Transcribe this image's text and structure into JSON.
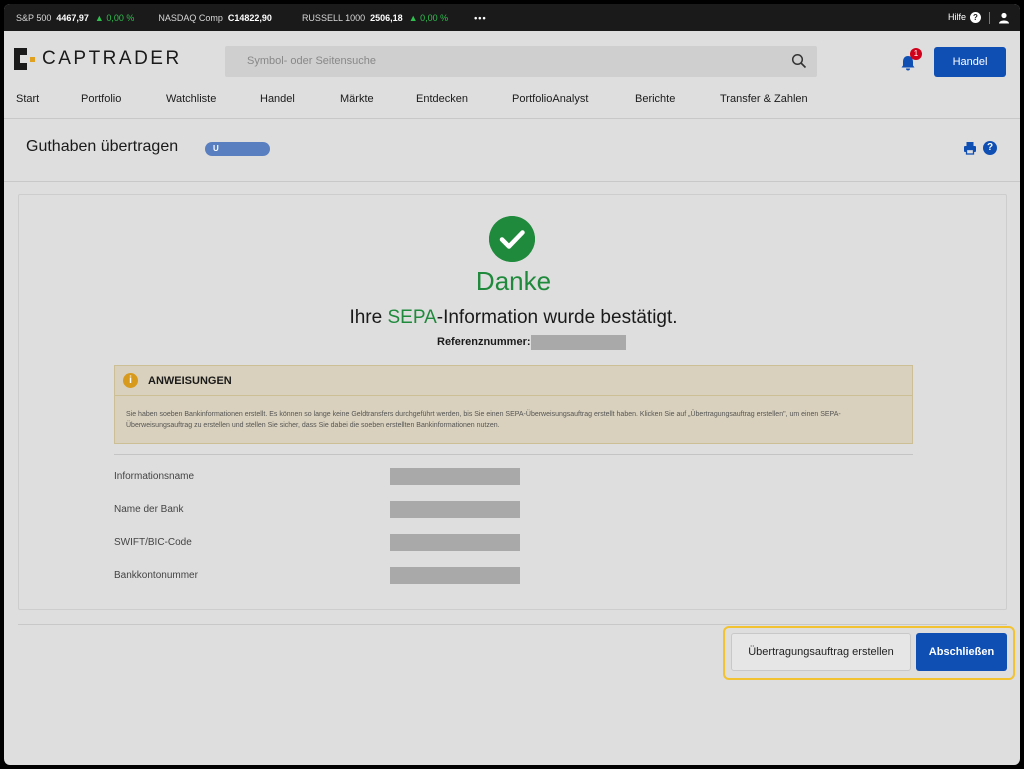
{
  "ticker": {
    "items": [
      {
        "name": "S&P 500",
        "value": "4467,97",
        "change": "▲ 0,00 %"
      },
      {
        "name": "NASDAQ Comp",
        "value": "C14822,90",
        "change": ""
      },
      {
        "name": "RUSSELL 1000",
        "value": "2506,18",
        "change": "▲ 0,00 %"
      }
    ],
    "more": "•••",
    "help_label": "Hilfe",
    "help_glyph": "?"
  },
  "header": {
    "logo_text": "CAPTRADER",
    "search_placeholder": "Symbol- oder Seitensuche",
    "notification_count": "1",
    "trade_button": "Handel"
  },
  "nav": {
    "items": [
      "Start",
      "Portfolio",
      "Watchliste",
      "Handel",
      "Märkte",
      "Entdecken",
      "PortfolioAnalyst",
      "Berichte",
      "Transfer & Zahlen"
    ]
  },
  "page": {
    "title": "Guthaben übertragen",
    "account_pill": "U",
    "help_glyph": "?"
  },
  "confirmation": {
    "heading": "Danke",
    "line_prefix": "Ihre ",
    "line_highlight": "SEPA",
    "line_suffix": "-Information wurde bestätigt.",
    "reference_label": "Referenznummer:"
  },
  "notice": {
    "icon_glyph": "i",
    "title": "ANWEISUNGEN",
    "text": "Sie haben soeben Bankinformationen erstellt. Es können so lange keine Geldtransfers durchgeführt werden, bis Sie einen SEPA-Überweisungsauftrag erstellt haben. Klicken Sie auf „Übertragungsauftrag erstellen\", um einen SEPA-Überweisungsauftrag zu erstellen und stellen Sie sicher, dass Sie dabei die soeben erstellten Bankinformationen nutzen."
  },
  "fields": [
    {
      "label": "Informationsname"
    },
    {
      "label": "Name der Bank"
    },
    {
      "label": "SWIFT/BIC-Code"
    },
    {
      "label": "Bankkontonummer"
    }
  ],
  "actions": {
    "create_transfer": "Übertragungsauftrag erstellen",
    "finish": "Abschließen"
  },
  "colors": {
    "primary": "#0f4fb4",
    "success": "#1f8a3c",
    "highlight_border": "#f2c230",
    "notice_bg": "#d9d1bd"
  }
}
